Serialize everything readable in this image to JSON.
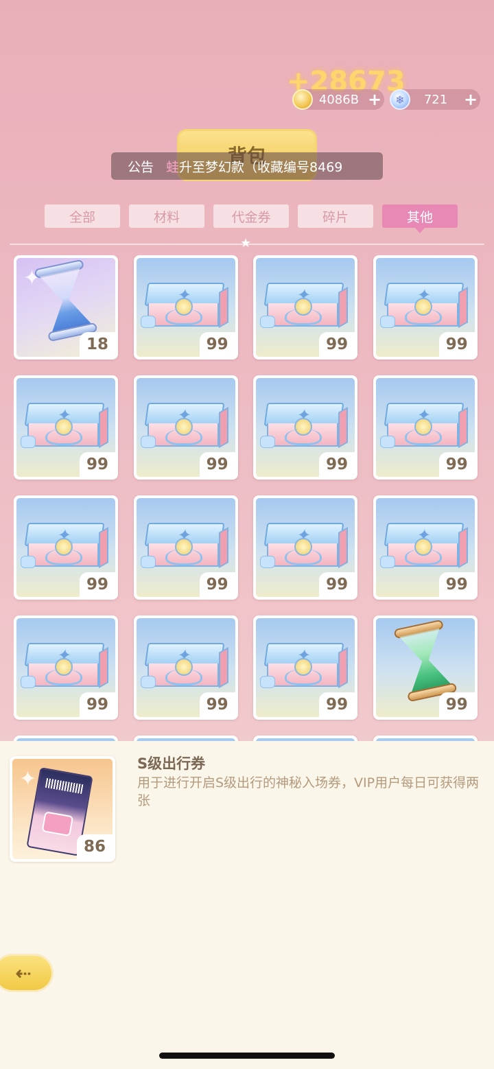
{
  "reward_popup": "+28673",
  "currencies": {
    "coin": {
      "icon": "coin-icon",
      "amount": "4086B",
      "plus": "+"
    },
    "gem": {
      "icon": "snowflake-gem-icon",
      "amount": "721",
      "plus": "+"
    }
  },
  "header": {
    "title": "背包"
  },
  "notice": {
    "label": "公告",
    "highlight": "蛙",
    "text": "升至梦幻款（收藏编号8469"
  },
  "tabs": [
    {
      "label": "全部",
      "active": false
    },
    {
      "label": "材料",
      "active": false
    },
    {
      "label": "代金券",
      "active": false
    },
    {
      "label": "碎片",
      "active": false
    },
    {
      "label": "其他",
      "active": true
    }
  ],
  "items": [
    {
      "icon": "blue-hourglass-icon",
      "count": "18"
    },
    {
      "icon": "gift-box-icon",
      "count": "99"
    },
    {
      "icon": "gift-box-icon",
      "count": "99"
    },
    {
      "icon": "gift-box-icon",
      "count": "99"
    },
    {
      "icon": "gift-box-icon",
      "count": "99"
    },
    {
      "icon": "gift-box-icon",
      "count": "99"
    },
    {
      "icon": "gift-box-icon",
      "count": "99"
    },
    {
      "icon": "gift-box-icon",
      "count": "99"
    },
    {
      "icon": "gift-box-icon",
      "count": "99"
    },
    {
      "icon": "gift-box-icon",
      "count": "99"
    },
    {
      "icon": "gift-box-icon",
      "count": "99"
    },
    {
      "icon": "gift-box-icon",
      "count": "99"
    },
    {
      "icon": "gift-box-icon",
      "count": "99"
    },
    {
      "icon": "gift-box-icon",
      "count": "99"
    },
    {
      "icon": "gift-box-icon",
      "count": "99"
    },
    {
      "icon": "green-hourglass-icon",
      "count": "99"
    }
  ],
  "detail": {
    "icon": "s-travel-ticket-icon",
    "name": "S级出行券",
    "description": "用于进行开启S级出行的神秘入场券，VIP用户每日可获得两张",
    "count": "86"
  },
  "back_button": {
    "icon": "back-arrow-icon",
    "glyph": "⇠"
  }
}
